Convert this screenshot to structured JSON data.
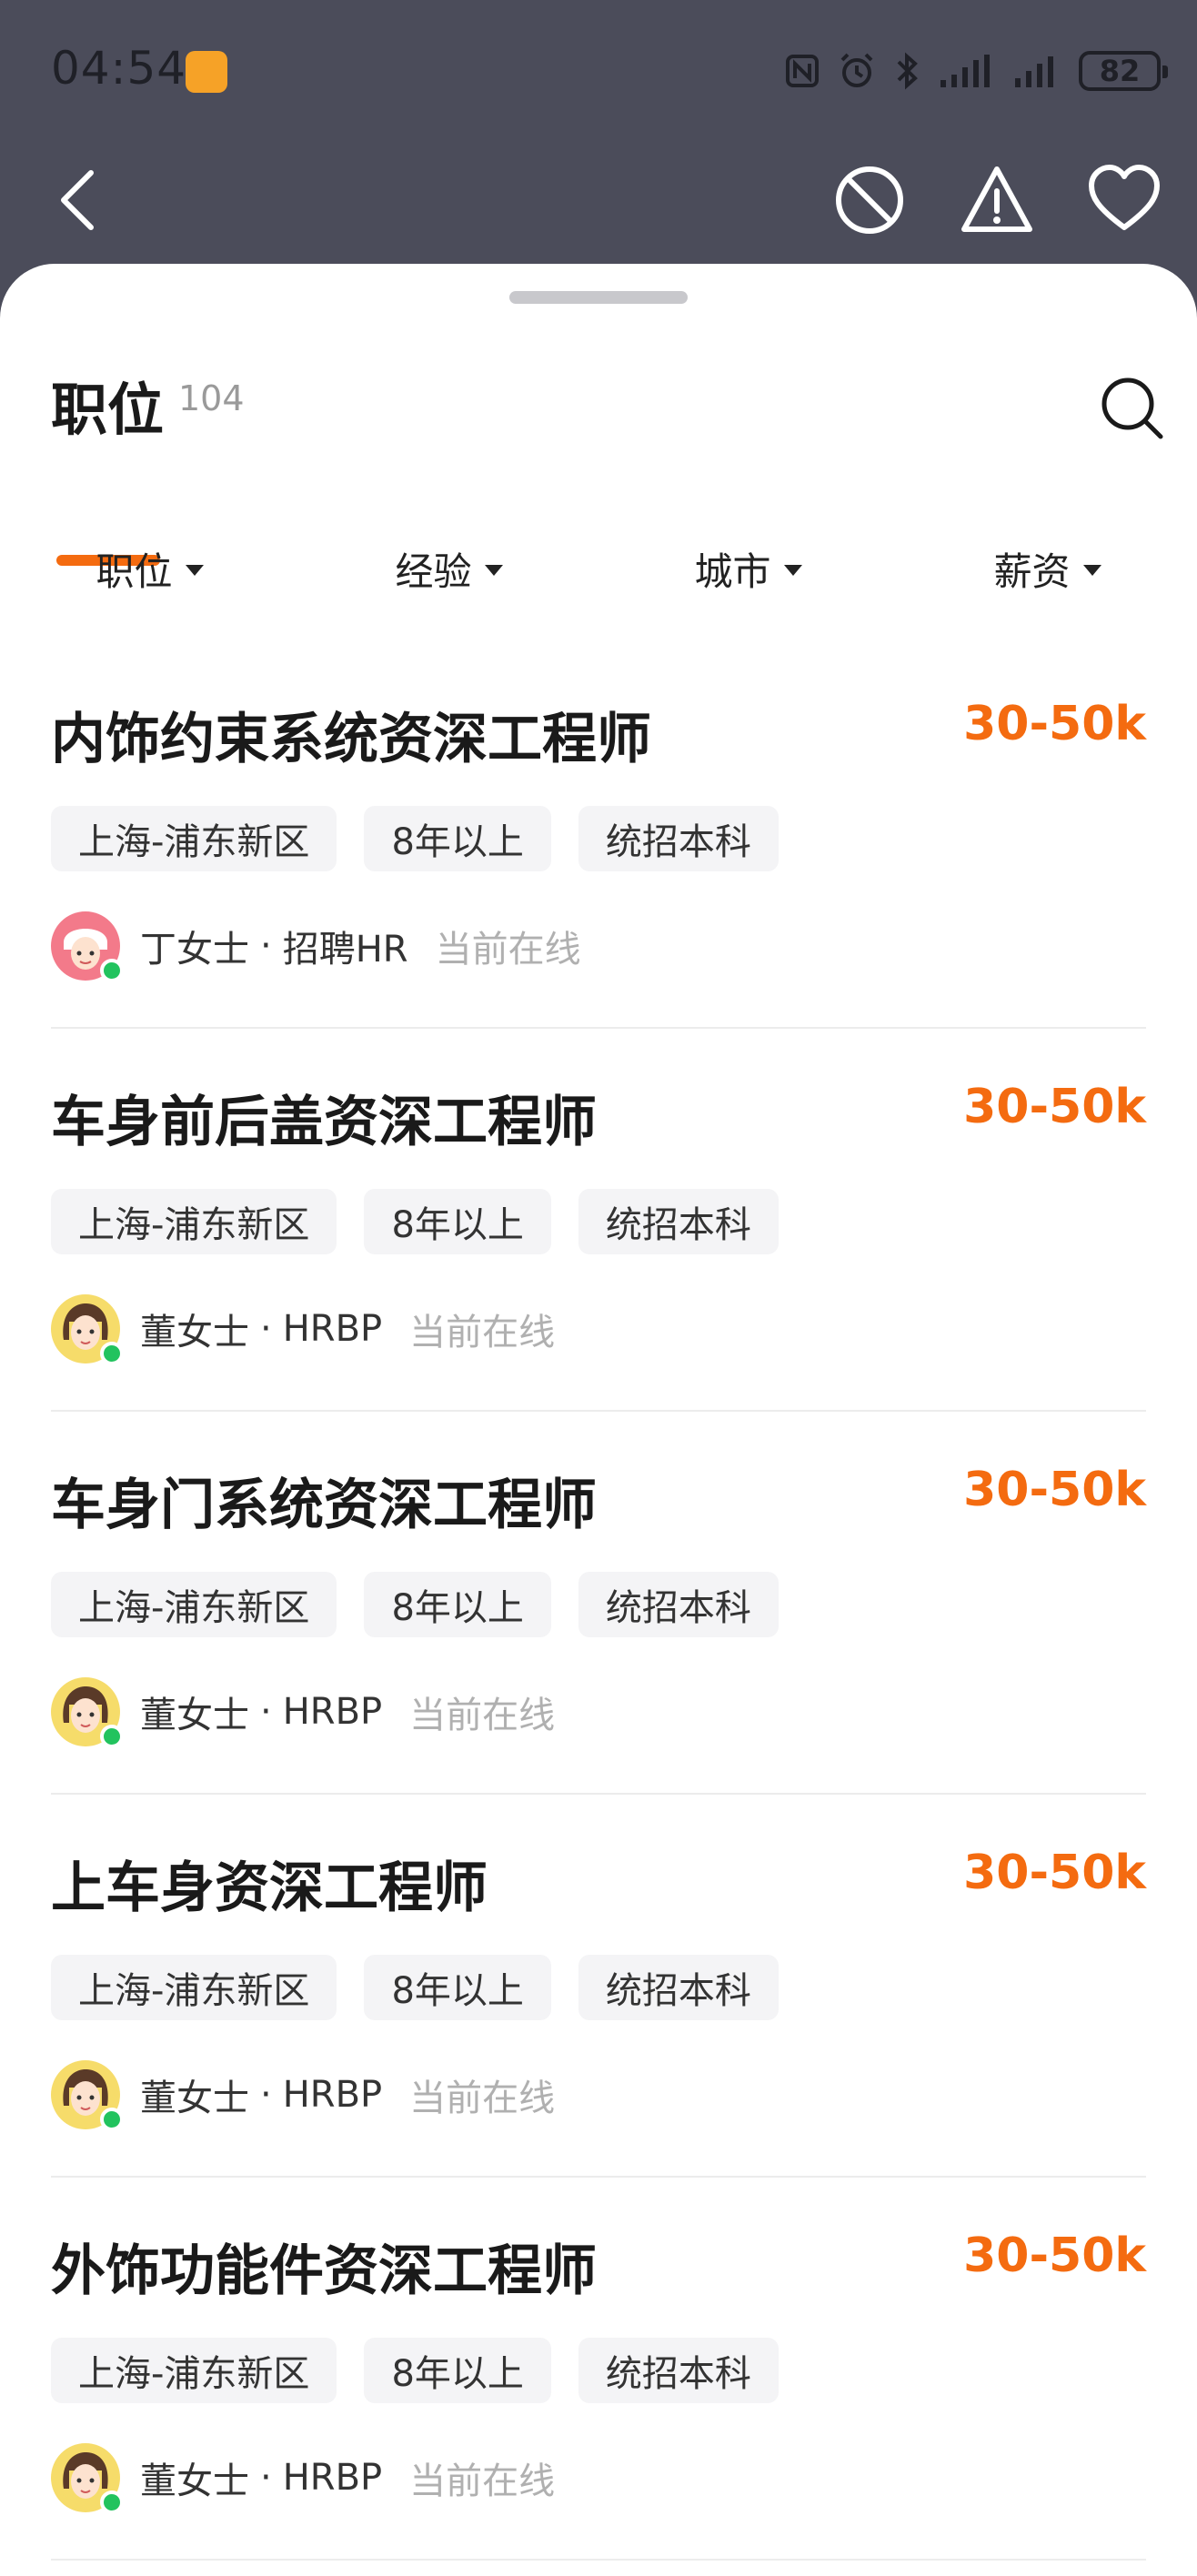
{
  "status_bar": {
    "time": "04:54",
    "battery": "82",
    "icons": [
      "nfc-icon",
      "alarm-icon",
      "bluetooth-icon",
      "signal-icon",
      "signal-icon"
    ]
  },
  "nav": {
    "back_icon": "chevron-left-icon",
    "actions": [
      "block-icon",
      "report-warning-icon",
      "favorite-heart-icon"
    ]
  },
  "header": {
    "tab_title": "职位",
    "tab_count": "104",
    "accent_color": "#f46b10"
  },
  "filters": [
    {
      "label": "职位"
    },
    {
      "label": "经验"
    },
    {
      "label": "城市"
    },
    {
      "label": "薪资"
    }
  ],
  "jobs": [
    {
      "title": "内饰约束系统资深工程师",
      "salary": "30-50k",
      "tags": [
        "上海-浦东新区",
        "8年以上",
        "统招本科"
      ],
      "recruiter": {
        "name": "丁女士",
        "sep": "·",
        "role": "招聘HR",
        "status": "当前在线",
        "avatar": "avatar-red"
      }
    },
    {
      "title": "车身前后盖资深工程师",
      "salary": "30-50k",
      "tags": [
        "上海-浦东新区",
        "8年以上",
        "统招本科"
      ],
      "recruiter": {
        "name": "董女士",
        "sep": "·",
        "role": "HRBP",
        "status": "当前在线",
        "avatar": "avatar-yellow"
      }
    },
    {
      "title": "车身门系统资深工程师",
      "salary": "30-50k",
      "tags": [
        "上海-浦东新区",
        "8年以上",
        "统招本科"
      ],
      "recruiter": {
        "name": "董女士",
        "sep": "·",
        "role": "HRBP",
        "status": "当前在线",
        "avatar": "avatar-yellow"
      }
    },
    {
      "title": "上车身资深工程师",
      "salary": "30-50k",
      "tags": [
        "上海-浦东新区",
        "8年以上",
        "统招本科"
      ],
      "recruiter": {
        "name": "董女士",
        "sep": "·",
        "role": "HRBP",
        "status": "当前在线",
        "avatar": "avatar-yellow"
      }
    },
    {
      "title": "外饰功能件资深工程师",
      "salary": "30-50k",
      "tags": [
        "上海-浦东新区",
        "8年以上",
        "统招本科"
      ],
      "recruiter": {
        "name": "董女士",
        "sep": "·",
        "role": "HRBP",
        "status": "当前在线",
        "avatar": "avatar-yellow"
      }
    }
  ]
}
